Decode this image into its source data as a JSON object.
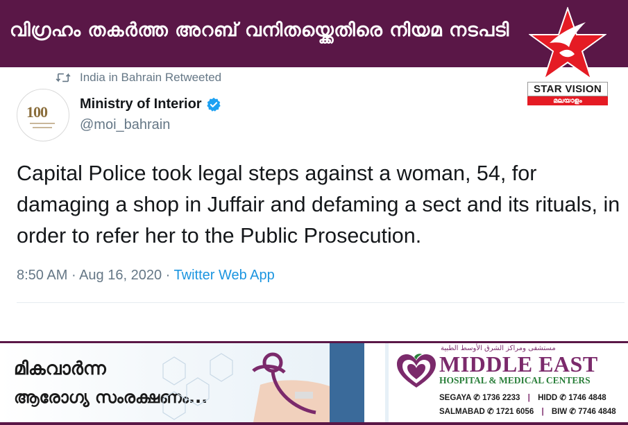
{
  "header": {
    "title": "വിഗ്രഹം തകർത്ത അറബ് വനിതയ്ക്കെതിരെ നിയമ നടപടി",
    "logo_name": "STAR VISION",
    "logo_sub": "മലയാളം"
  },
  "tweet": {
    "retweet_label": "India in Bahrain Retweeted",
    "avatar_text": "100",
    "display_name": "Ministry of Interior",
    "handle": "@moi_bahrain",
    "text": "Capital Police took legal steps against a woman, 54, for damaging a shop in Juffair and defaming a sect and its rituals, in order to refer her to the Public Prosecution.",
    "time": "8:50 AM",
    "date": "Aug 16, 2020",
    "source": "Twitter Web App",
    "separator": "·"
  },
  "ad": {
    "line1": "മികവാർന്ന",
    "line2": "ആരോഗ്യ സംരക്ഷണം...",
    "brand_arabic": "مستشفى ومراكز الشرق الأوسط الطبية",
    "brand": "MIDDLE EAST",
    "brand_sub": "HOSPITAL & MEDICAL CENTERS",
    "phones": [
      {
        "place": "SEGAYA",
        "number": "1736 2233"
      },
      {
        "place": "HIDD",
        "number": "1746 4848"
      },
      {
        "place": "SALMABAD",
        "number": "1721 6056"
      },
      {
        "place": "BIW",
        "number": "7746 4848"
      }
    ]
  },
  "colors": {
    "banner": "#5a1747",
    "star": "#e51b24",
    "link": "#1b95e0",
    "verified": "#1da1f2",
    "brand": "#7b2a6b"
  },
  "icons": [
    "retweet-icon",
    "verified-badge-icon",
    "star-logo-icon",
    "heart-logo-icon",
    "phone-icon"
  ]
}
